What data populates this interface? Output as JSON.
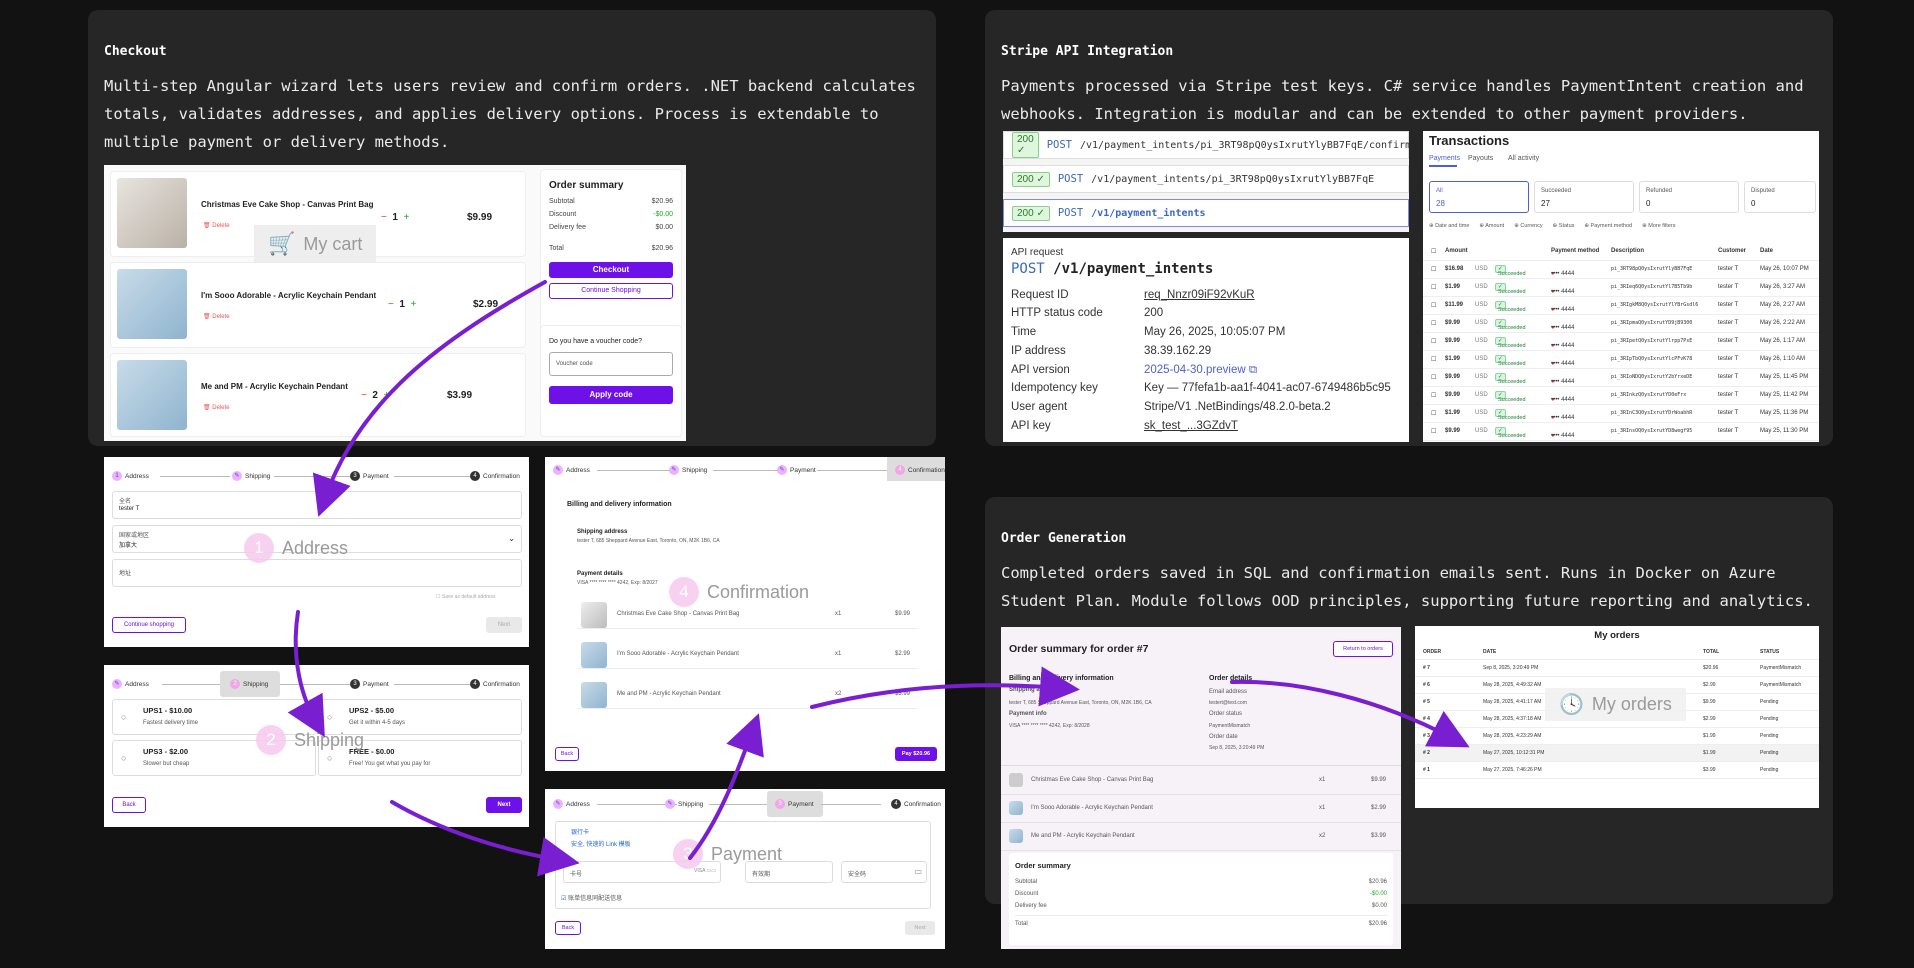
{
  "checkout": {
    "title": "Checkout",
    "desc": "Multi-step Angular wizard lets users review and confirm orders. .NET backend calculates totals, validates addresses, and applies delivery options. Process is extendable to multiple payment or delivery methods."
  },
  "stripe": {
    "title": "Stripe API Integration",
    "desc": "Payments processed via Stripe test keys. C# service handles PaymentIntent creation and webhooks. Integration is modular and can be extended to other payment providers."
  },
  "ordergen": {
    "title": "Order Generation",
    "desc": "Completed orders saved in SQL and confirmation emails sent. Runs in Docker on Azure Student Plan. Module follows OOD principles, supporting future reporting and analytics."
  },
  "cart": {
    "watermark": "My cart",
    "items": [
      {
        "name": "Christmas Eve Cake Shop - Canvas Print Bag",
        "delete": "Delete",
        "qty": "1",
        "price": "$9.99"
      },
      {
        "name": "I'm Sooo Adorable - Acrylic Keychain Pendant",
        "delete": "Delete",
        "qty": "1",
        "price": "$2.99"
      },
      {
        "name": "Me and PM - Acrylic Keychain Pendant",
        "delete": "Delete",
        "qty": "2",
        "price": "$3.99"
      }
    ],
    "summary": {
      "title": "Order summary",
      "subtotal_label": "Subtotal",
      "subtotal": "$20.96",
      "discount_label": "Discount",
      "discount": "-$0.00",
      "fee_label": "Delivery fee",
      "fee": "$0.00",
      "total_label": "Total",
      "total": "$20.96",
      "checkout": "Checkout",
      "continue": "Continue Shopping",
      "voucher_q": "Do you have a voucher code?",
      "voucher_ph": "Voucher code",
      "apply": "Apply code"
    }
  },
  "steps": {
    "address": "Address",
    "shipping": "Shipping",
    "payment": "Payment",
    "confirmation": "Confirmation",
    "n1": "1",
    "n2": "2",
    "n3": "3",
    "n4": "4"
  },
  "address_form": {
    "name_label": "全名",
    "name_value": "tester T",
    "country_label": "国家或地区",
    "country_value": "加拿大",
    "addr_label": "地址",
    "save": "Save as default address",
    "continue": "Continue shopping",
    "next": "Next",
    "watermark": "Address",
    "wm_num": "1"
  },
  "shipping_form": {
    "watermark": "Shipping",
    "wm_num": "2",
    "opts": [
      {
        "title": "UPS1 - $10.00",
        "sub": "Fastest delivery time"
      },
      {
        "title": "UPS2 - $5.00",
        "sub": "Get it within 4-5 days"
      },
      {
        "title": "UPS3 - $2.00",
        "sub": "Slower but cheap"
      },
      {
        "title": "FREE - $0.00",
        "sub": "Free! You get what you pay for"
      }
    ],
    "back": "Back",
    "next": "Next"
  },
  "confirm_form": {
    "watermark": "Confirmation",
    "wm_num": "4",
    "heading": "Billing and delivery information",
    "ship_label": "Shipping address",
    "ship_value": "tester T, 685 Sheppard Avenue East, Toronto, ON, M2K 1B6, CA",
    "pay_label": "Payment details",
    "pay_value": "VISA **** **** **** 4242, Exp: 8/2027",
    "items": [
      {
        "name": "Christmas Eve Cake Shop - Canvas Print Bag",
        "qty": "x1",
        "price": "$9.99"
      },
      {
        "name": "I'm Sooo Adorable - Acrylic Keychain Pendant",
        "qty": "x1",
        "price": "$2.99"
      },
      {
        "name": "Me and PM - Acrylic Keychain Pendant",
        "qty": "x2",
        "price": "$3.99"
      }
    ],
    "back": "Back",
    "pay": "Pay $20.96"
  },
  "payment_form": {
    "watermark": "Payment",
    "wm_num": "3",
    "card": "银行卡",
    "link": "安全, 快速的 Link 模板",
    "card_no": "卡号",
    "exp": "有效期",
    "cvc": "安全码",
    "same": "账单信息同配送信息",
    "back": "Back",
    "next": "Next"
  },
  "api": {
    "rows": [
      {
        "code": "200",
        "method": "POST",
        "path": "/v1/payment_intents/pi_3RT98pQ0ysIxrutYlyBB7FqE/confirm"
      },
      {
        "code": "200",
        "method": "POST",
        "path": "/v1/payment_intents/pi_3RT98pQ0ysIxrutYlyBB7FqE"
      },
      {
        "code": "200",
        "method": "POST",
        "path": "/v1/payment_intents"
      }
    ],
    "req_label": "API request",
    "req_method": "POST",
    "req_path": "/v1/payment_intents",
    "details": [
      {
        "k": "Request ID",
        "v": "req_Nnzr09iF92vKuR"
      },
      {
        "k": "HTTP status code",
        "v": "200"
      },
      {
        "k": "Time",
        "v": "May 26, 2025, 10:05:07 PM"
      },
      {
        "k": "IP address",
        "v": "38.39.162.29"
      },
      {
        "k": "API version",
        "v": "2025-04-30.preview"
      },
      {
        "k": "Idempotency key",
        "v": "Key — 77fefa1b-aa1f-4041-ac07-6749486b5c95"
      },
      {
        "k": "User agent",
        "v": "Stripe/V1 .NetBindings/48.2.0-beta.2"
      },
      {
        "k": "API key",
        "v": "sk_test_...3GZdvT"
      }
    ]
  },
  "tx": {
    "title": "Transactions",
    "tabs": [
      "Payments",
      "Payouts",
      "All activity"
    ],
    "filters": [
      {
        "label": "All",
        "count": "28"
      },
      {
        "label": "Succeeded",
        "count": "27"
      },
      {
        "label": "Refunded",
        "count": "0"
      },
      {
        "label": "Disputed",
        "count": "0"
      }
    ],
    "chips": [
      "Date and time",
      "Amount",
      "Currency",
      "Status",
      "Payment method",
      "More filters"
    ],
    "cols": [
      "Amount",
      "Payment method",
      "Description",
      "Customer",
      "Date"
    ],
    "rows": [
      {
        "amt": "$16.98",
        "cur": "USD",
        "st": "Succeeded",
        "pm": "•••• 4444",
        "desc": "pi_3RT98pQ0ysIxrutYlyBB7FqE",
        "cust": "tester T",
        "date": "May 26, 10:07 PM"
      },
      {
        "amt": "$1.99",
        "cur": "USD",
        "st": "Succeeded",
        "pm": "•••• 4444",
        "desc": "pi_3RIeq6Q0ysIxrutYl7B5Tb9b",
        "cust": "tester T",
        "date": "May 26, 3:27 AM"
      },
      {
        "amt": "$11.99",
        "cur": "USD",
        "st": "Succeeded",
        "pm": "•••• 4444",
        "desc": "pi_3RIgkM8Q0ysIxrutYlYBrGsdl6",
        "cust": "tester T",
        "date": "May 26, 2:27 AM"
      },
      {
        "amt": "$9.99",
        "cur": "USD",
        "st": "Succeeded",
        "pm": "•••• 4444",
        "desc": "pi_3RIpmaQ0ysIxrutYD9jB9300",
        "cust": "tester T",
        "date": "May 26, 2:22 AM"
      },
      {
        "amt": "$9.99",
        "cur": "USD",
        "st": "Succeeded",
        "pm": "•••• 4444",
        "desc": "pi_3RIpetQ0ysIxrutYlrpp7PsE",
        "cust": "tester T",
        "date": "May 26, 1:17 AM"
      },
      {
        "amt": "$1.99",
        "cur": "USD",
        "st": "Succeeded",
        "pm": "•••• 4444",
        "desc": "pi_3RIpTbQ0ysIxrutYlcPFvK78",
        "cust": "tester T",
        "date": "May 26, 1:10 AM"
      },
      {
        "amt": "$9.99",
        "cur": "USD",
        "st": "Succeeded",
        "pm": "•••• 4444",
        "desc": "pi_3RIoNDQ0ysIxrutY2bYrxeDE",
        "cust": "tester T",
        "date": "May 25, 11:45 PM"
      },
      {
        "amt": "$9.99",
        "cur": "USD",
        "st": "Succeeded",
        "pm": "•••• 4444",
        "desc": "pi_3RInkzQ0ysIxrutYD0eFrx",
        "cust": "tester T",
        "date": "May 25, 11:42 PM"
      },
      {
        "amt": "$1.99",
        "cur": "USD",
        "st": "Succeeded",
        "pm": "•••• 4444",
        "desc": "pi_3RInC3Q0ysIxrutYDrWoabhR",
        "cust": "tester T",
        "date": "May 25, 11:36 PM"
      },
      {
        "amt": "$9.99",
        "cur": "USD",
        "st": "Succeeded",
        "pm": "•••• 4444",
        "desc": "pi_3RInsOQ0ysIxrutYD8wegf95",
        "cust": "tester T",
        "date": "May 25, 11:30 PM"
      }
    ]
  },
  "order7": {
    "title": "Order summary for order #7",
    "return": "Return to orders",
    "bill_heading": "Billing and delivery information",
    "ship_label": "Shipping address",
    "ship_value": "tester T, 685 Sheppard Avenue East, Toronto, ON, M2K 1B6, CA",
    "pay_label": "Payment info",
    "pay_value": "VISA **** **** **** 4242, Exp: 8/2028",
    "det_heading": "Order details",
    "email_label": "Email address",
    "email": "testert@test.com",
    "status_label": "Order status",
    "status": "PaymentMismatch",
    "date_label": "Order date",
    "date": "Sep 8, 2025, 3:20:49 PM",
    "items": [
      {
        "name": "Christmas Eve Cake Shop - Canvas Print Bag",
        "qty": "x1",
        "price": "$9.99"
      },
      {
        "name": "I'm Sooo Adorable - Acrylic Keychain Pendant",
        "qty": "x1",
        "price": "$2.99"
      },
      {
        "name": "Me and PM - Acrylic Keychain Pendant",
        "qty": "x2",
        "price": "$3.99"
      }
    ],
    "sum_title": "Order summary",
    "subtotal_label": "Subtotal",
    "subtotal": "$20.96",
    "discount_label": "Discount",
    "discount": "-$0.00",
    "fee_label": "Delivery fee",
    "fee": "$0.00",
    "total_label": "Total",
    "total": "$20.96"
  },
  "myorders": {
    "title": "My orders",
    "watermark": "My orders",
    "cols": [
      "ORDER",
      "DATE",
      "TOTAL",
      "STATUS"
    ],
    "rows": [
      {
        "o": "# 7",
        "d": "Sep 8, 2025, 3:20:49 PM",
        "t": "$20.96",
        "s": "PaymentMismatch"
      },
      {
        "o": "# 6",
        "d": "May 28, 2025, 4:49:32 AM",
        "t": "$2.99",
        "s": "PaymentMismatch"
      },
      {
        "o": "# 5",
        "d": "May 28, 2025, 4:41:17 AM",
        "t": "$9.99",
        "s": "Pending"
      },
      {
        "o": "# 4",
        "d": "May 28, 2025, 4:37:18 AM",
        "t": "$2.99",
        "s": "Pending"
      },
      {
        "o": "# 3",
        "d": "May 28, 2025, 4:23:29 AM",
        "t": "$1.99",
        "s": "Pending"
      },
      {
        "o": "# 2",
        "d": "May 27, 2025, 10:12:31 PM",
        "t": "$1.99",
        "s": "Pending"
      },
      {
        "o": "# 1",
        "d": "May 27, 2025, 7:46:26 PM",
        "t": "$3.99",
        "s": "Pending"
      }
    ]
  }
}
